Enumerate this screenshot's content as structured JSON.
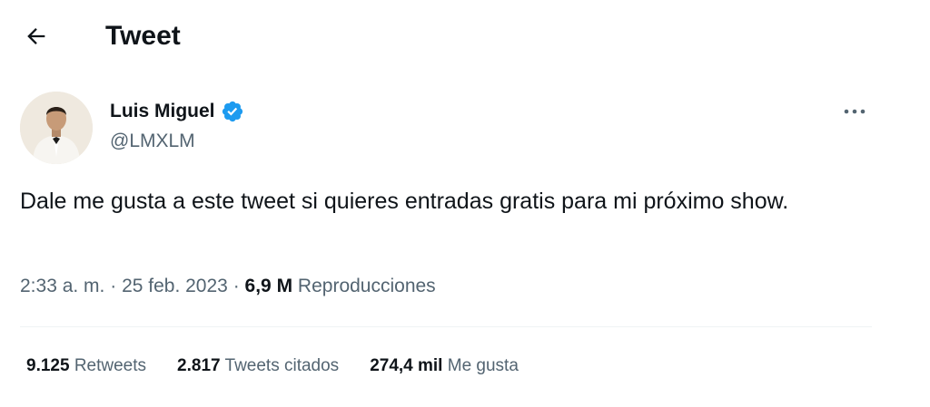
{
  "header": {
    "title": "Tweet",
    "back_icon": "arrow-left-icon"
  },
  "author": {
    "name": "Luis Miguel",
    "handle": "@LMXLM",
    "verified": true,
    "verified_color": "#1d9bf0",
    "avatar_icon": "avatar-image"
  },
  "more_icon": "more-options-icon",
  "tweet": {
    "text": "Dale me gusta a este tweet si quieres entradas gratis para mi próximo show."
  },
  "meta": {
    "time": "2:33 a. m.",
    "separator": "·",
    "date": "25 feb. 2023",
    "views_count": "6,9 M",
    "views_label": "Reproducciones"
  },
  "stats": {
    "retweets_count": "9.125",
    "retweets_label": "Retweets",
    "quotes_count": "2.817",
    "quotes_label": "Tweets citados",
    "likes_count": "274,4 mil",
    "likes_label": "Me gusta"
  }
}
